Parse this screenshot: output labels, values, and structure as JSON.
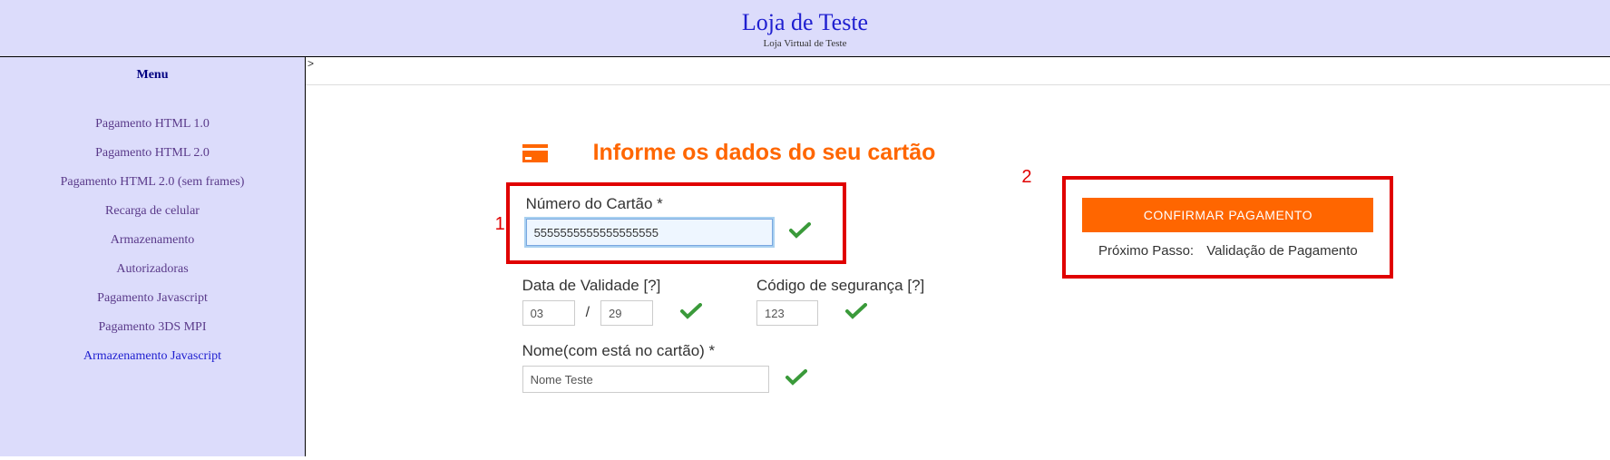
{
  "header": {
    "title": "Loja de Teste",
    "subtitle": "Loja Virtual de Teste"
  },
  "sidebar": {
    "title": "Menu",
    "items": [
      {
        "label": "Pagamento HTML 1.0"
      },
      {
        "label": "Pagamento HTML 2.0"
      },
      {
        "label": "Pagamento HTML 2.0 (sem frames)"
      },
      {
        "label": "Recarga de celular"
      },
      {
        "label": "Armazenamento"
      },
      {
        "label": "Autorizadoras"
      },
      {
        "label": "Pagamento Javascript"
      },
      {
        "label": "Pagamento 3DS MPI"
      },
      {
        "label": "Armazenamento Javascript"
      }
    ]
  },
  "breadcrumb": ">",
  "form": {
    "title": "Informe os dados do seu cartão",
    "card_number_label": "Número do Cartão *",
    "card_number_value": "5555555555555555555",
    "expiry_label": "Data de Validade [?]",
    "expiry_month": "03",
    "expiry_year": "29",
    "cvv_label": "Código de segurança [?]",
    "cvv_value": "123",
    "name_label": "Nome(com está no cartão) *",
    "name_value": "Nome Teste"
  },
  "annotations": {
    "one": "1",
    "two": "2"
  },
  "confirm": {
    "button_label": "CONFIRMAR PAGAMENTO",
    "next_step_label": "Próximo Passo:",
    "next_step_value": "Validação de Pagamento"
  }
}
